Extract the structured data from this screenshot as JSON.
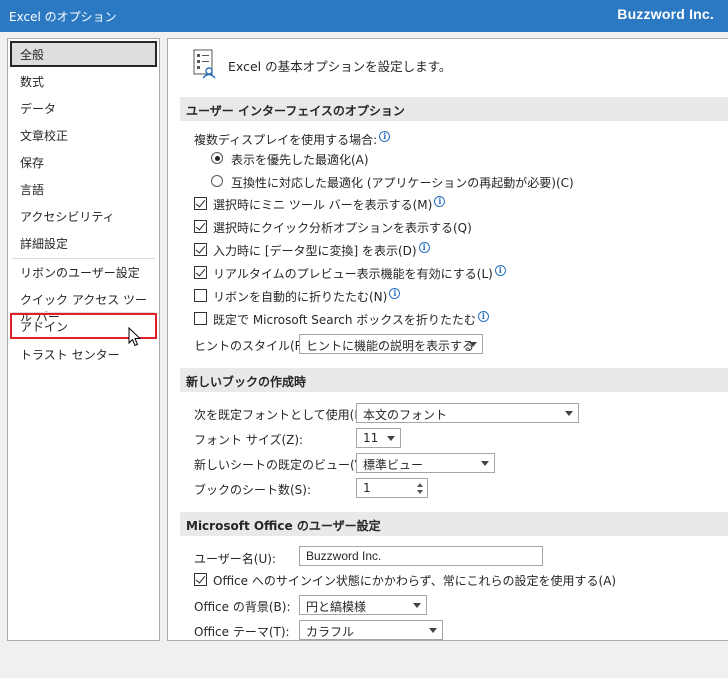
{
  "window": {
    "title": "Excel のオプション",
    "brand": "Buzzword Inc."
  },
  "sidebar": {
    "items": [
      {
        "label": "全般"
      },
      {
        "label": "数式"
      },
      {
        "label": "データ"
      },
      {
        "label": "文章校正"
      },
      {
        "label": "保存"
      },
      {
        "label": "言語"
      },
      {
        "label": "アクセシビリティ"
      },
      {
        "label": "詳細設定"
      },
      {
        "label": "リボンのユーザー設定"
      },
      {
        "label": "クイック アクセス ツール バー"
      },
      {
        "label": "アドイン"
      },
      {
        "label": "トラスト センター"
      }
    ],
    "selected": "全般",
    "highlighted": "アドイン"
  },
  "main": {
    "header": "Excel の基本オプションを設定します。",
    "ui_section": {
      "title": "ユーザー インターフェイスのオプション",
      "multi_display_label": "複数ディスプレイを使用する場合:",
      "radio_1": "表示を優先した最適化(A)",
      "radio_2": "互換性に対応した最適化 (アプリケーションの再起動が必要)(C)",
      "cb_mini_toolbar": "選択時にミニ ツール バーを表示する(M)",
      "cb_quick_analysis": "選択時にクイック分析オプションを表示する(Q)",
      "cb_data_types": "入力時に [データ型に変換] を表示(D)",
      "cb_live_preview": "リアルタイムのプレビュー表示機能を有効にする(L)",
      "cb_collapse_ribbon": "リボンを自動的に折りたたむ(N)",
      "cb_search_box": "既定で Microsoft Search ボックスを折りたたむ",
      "screentip_label": "ヒントのスタイル(R):",
      "screentip_value": "ヒントに機能の説明を表示する"
    },
    "new_book": {
      "title": "新しいブックの作成時",
      "font_label": "次を既定フォントとして使用(N):",
      "font_value": "本文のフォント",
      "size_label": "フォント サイズ(Z):",
      "size_value": "11",
      "view_label": "新しいシートの既定のビュー(V):",
      "view_value": "標準ビュー",
      "sheets_label": "ブックのシート数(S):",
      "sheets_value": "1"
    },
    "personalize": {
      "title": "Microsoft Office のユーザー設定",
      "user_label": "ユーザー名(U):",
      "user_value": "Buzzword Inc.",
      "cb_always_use": "Office へのサインイン状態にかかわらず、常にこれらの設定を使用する(A)",
      "background_label": "Office の背景(B):",
      "background_value": "円と縞模様",
      "theme_label": "Office テーマ(T):",
      "theme_value": "カラフル"
    }
  },
  "info_icon": "info-icon",
  "colors": {
    "titlebar": "#2b79c2",
    "highlight_border": "#e02028"
  }
}
